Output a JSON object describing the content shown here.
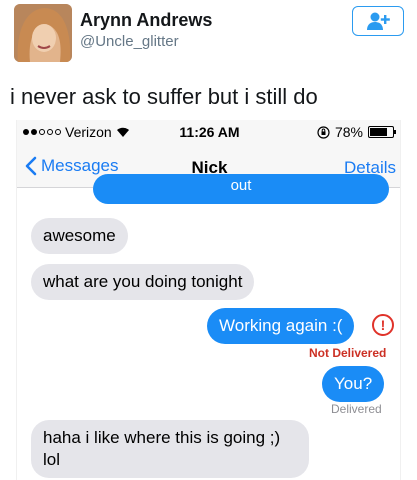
{
  "tweet": {
    "author_name": "Arynn Andrews",
    "author_handle": "@Uncle_glitter",
    "text": "i never ask to suffer but i still do",
    "follow_icon": "add-user-icon"
  },
  "status_bar": {
    "carrier": "Verizon",
    "time": "11:26 AM",
    "battery": "78%",
    "battery_level": 0.78
  },
  "nav": {
    "back_label": "Messages",
    "title": "Nick",
    "details_label": "Details"
  },
  "messages": {
    "partial_text": "out",
    "m1": "awesome",
    "m2": "what are you doing tonight",
    "m3": "Working again :(",
    "m3_status": "Not Delivered",
    "m4": "You?",
    "m4_status": "Delivered",
    "m5_line1": "haha i like where this is going ;)",
    "m5_line2": "lol"
  },
  "colors": {
    "imessage_blue": "#1a8cf6",
    "ios_link": "#1a7cf3",
    "error_red": "#cc3024"
  }
}
